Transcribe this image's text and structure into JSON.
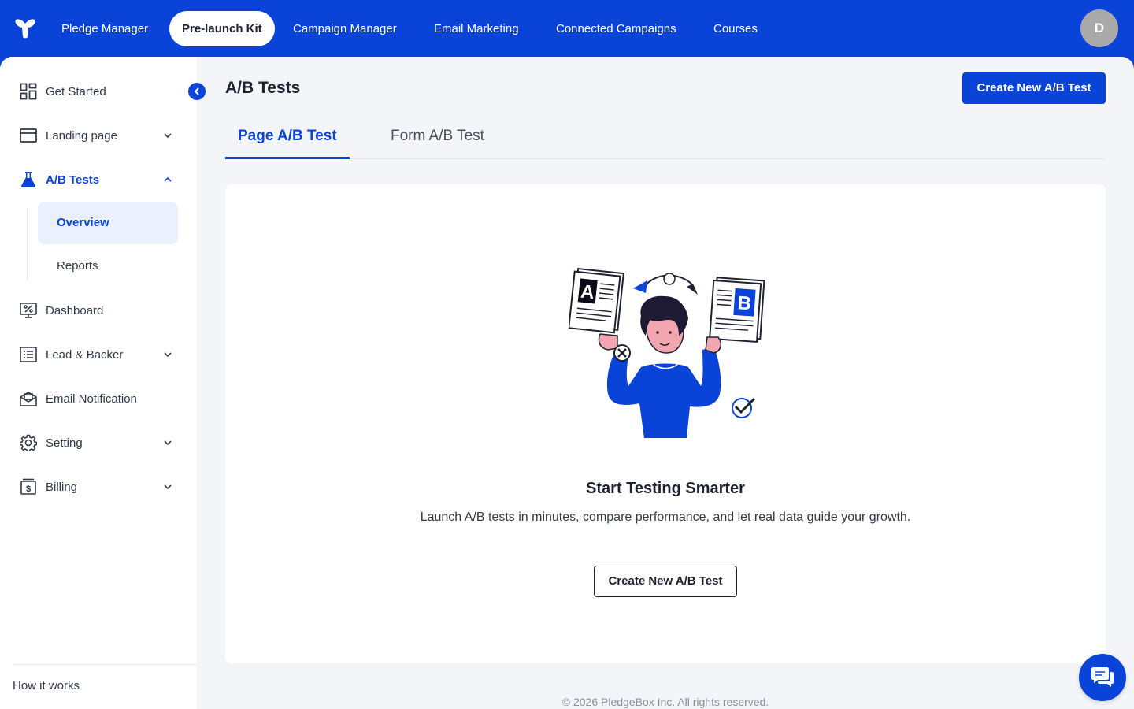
{
  "topnav": {
    "items": [
      {
        "label": "Pledge Manager"
      },
      {
        "label": "Pre-launch Kit"
      },
      {
        "label": "Campaign Manager"
      },
      {
        "label": "Email Marketing"
      },
      {
        "label": "Connected Campaigns"
      },
      {
        "label": "Courses"
      }
    ],
    "active_index": 1,
    "avatar_initial": "D"
  },
  "sidebar": {
    "items": [
      {
        "label": "Get Started",
        "icon": "grid-icon",
        "has_chevron": false
      },
      {
        "label": "Landing page",
        "icon": "browser-window-icon",
        "has_chevron": true
      },
      {
        "label": "A/B Tests",
        "icon": "flask-icon",
        "has_chevron": true,
        "expanded": true,
        "active": true
      },
      {
        "label": "Dashboard",
        "icon": "monitor-percent-icon",
        "has_chevron": false
      },
      {
        "label": "Lead & Backer",
        "icon": "list-icon",
        "has_chevron": true
      },
      {
        "label": "Email Notification",
        "icon": "envelope-icon",
        "has_chevron": false
      },
      {
        "label": "Setting",
        "icon": "gear-icon",
        "has_chevron": true
      },
      {
        "label": "Billing",
        "icon": "dollar-bill-icon",
        "has_chevron": true
      }
    ],
    "sub_items": [
      {
        "label": "Overview",
        "active": true
      },
      {
        "label": "Reports",
        "active": false
      }
    ],
    "footer_link": "How it works"
  },
  "main": {
    "title": "A/B Tests",
    "create_button": "Create New A/B Test",
    "tabs": [
      {
        "label": "Page A/B Test",
        "active": true
      },
      {
        "label": "Form A/B Test",
        "active": false
      }
    ],
    "empty_state": {
      "illustration": "ab-test-person-illustration",
      "title": "Start Testing Smarter",
      "description": "Launch A/B tests in minutes, compare performance, and let real data guide your growth.",
      "button": "Create New A/B Test"
    },
    "footer": "© 2026 PledgeBox Inc. All rights reserved."
  },
  "colors": {
    "brand": "#0a43d8",
    "background": "#f4f5f9",
    "active_sub_bg": "#eaf0fd"
  }
}
